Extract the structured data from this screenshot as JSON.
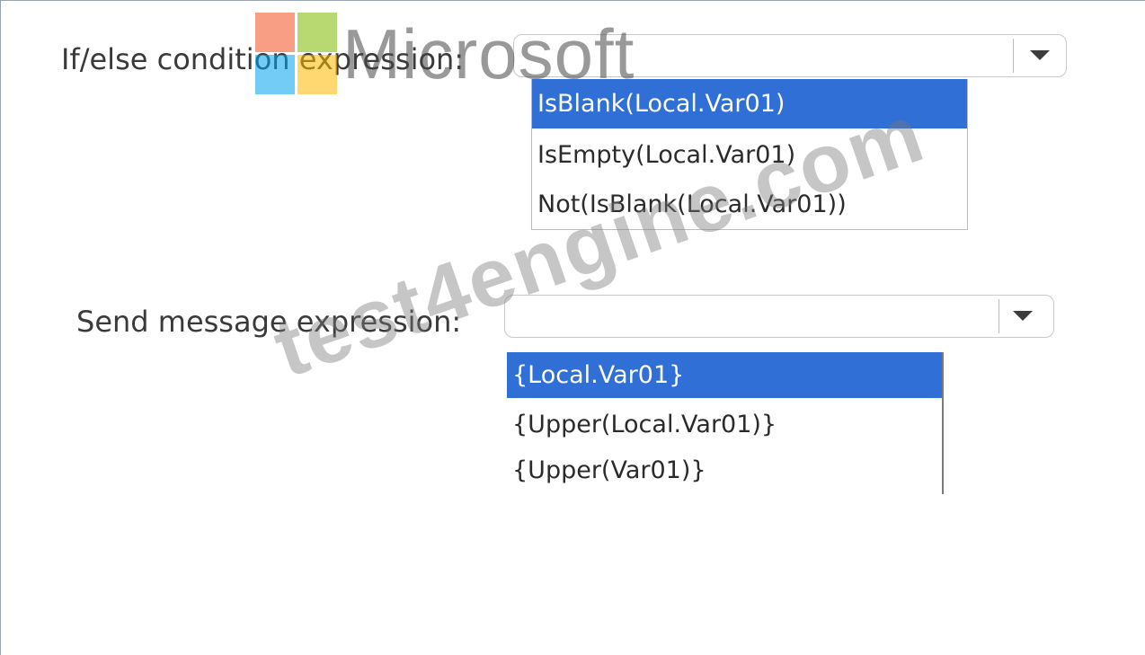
{
  "if_else": {
    "label": "If/else condition expression:",
    "options": [
      "IsBlank(Local.Var01)",
      "IsEmpty(Local.Var01)",
      "Not(IsBlank(Local.Var01))"
    ],
    "highlighted_option": "IsBlank(Local.Var01)"
  },
  "send_message": {
    "label": "Send message expression:",
    "options": [
      "{Local.Var01}",
      "{Upper(Local.Var01)}",
      "{Upper(Var01)}"
    ],
    "highlighted_option": "{Local.Var01}"
  },
  "watermarks": {
    "brand": "Microsoft",
    "site": "test4engine.com",
    "logo_colors": [
      "#f25022",
      "#7fba00",
      "#00a4ef",
      "#ffb900"
    ]
  },
  "colors": {
    "highlight": "#2f6fd6"
  },
  "icons": {
    "dropdown": "chevron-down-icon"
  }
}
